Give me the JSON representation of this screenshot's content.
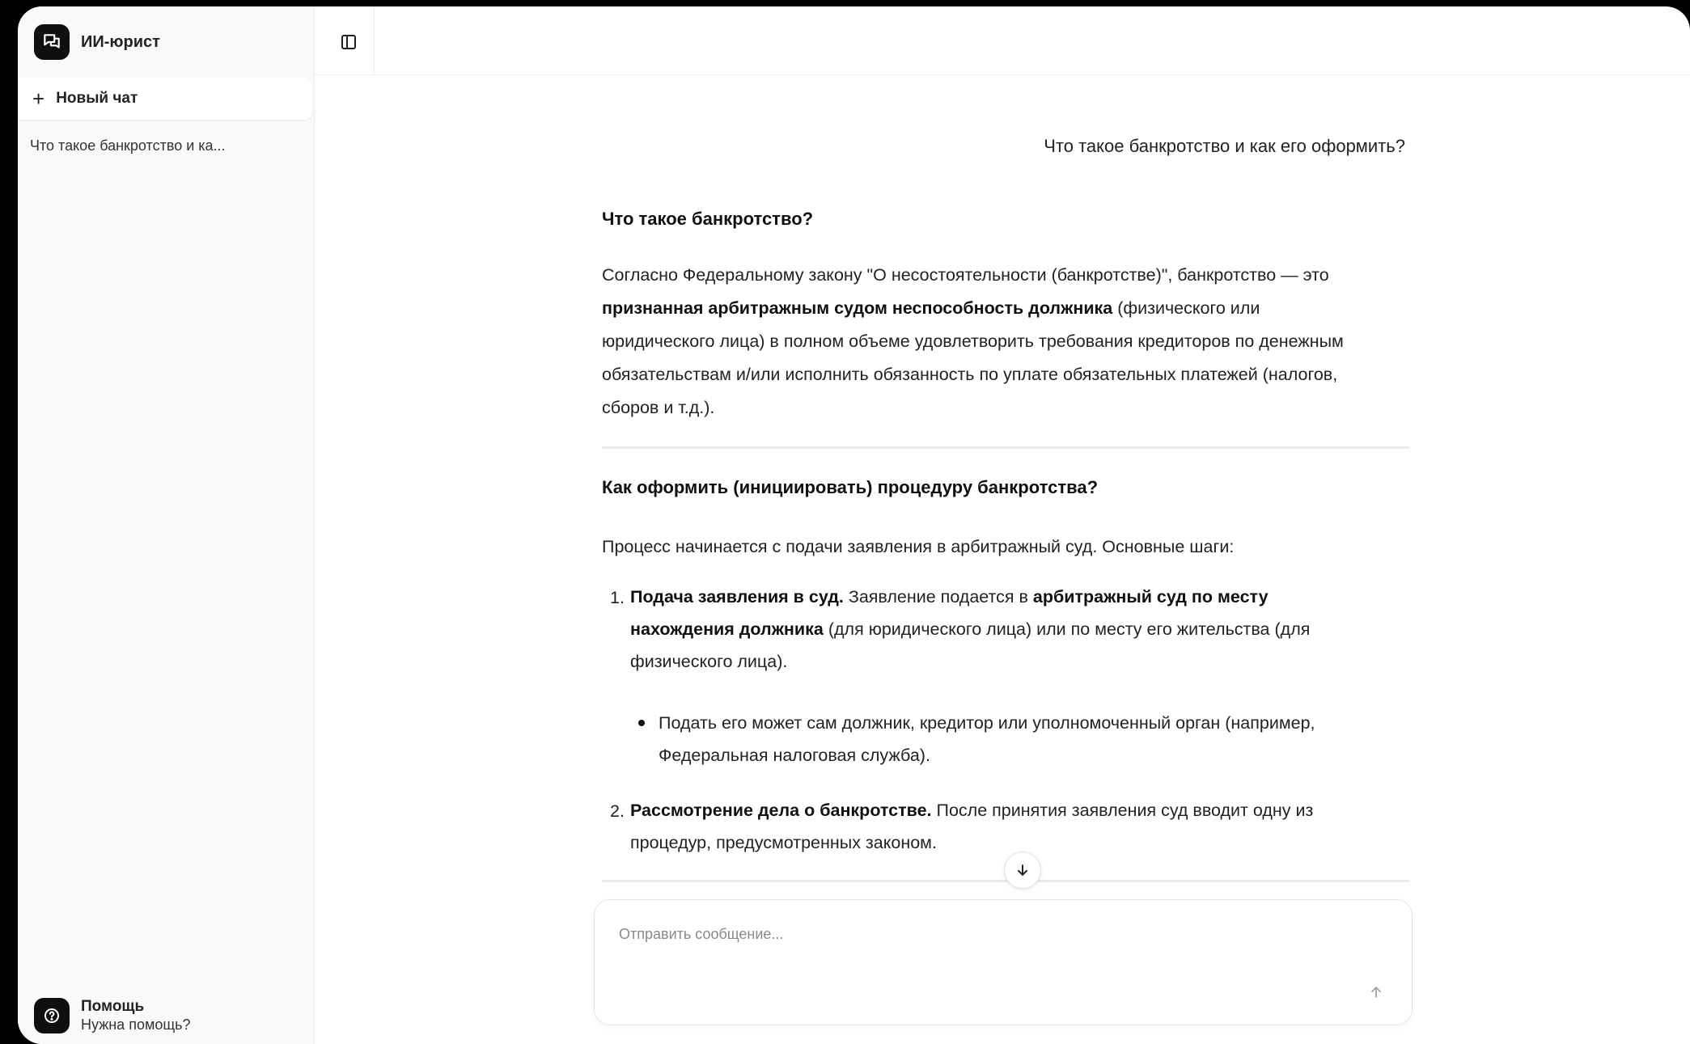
{
  "sidebar": {
    "brand_name": "ИИ-юрист",
    "new_chat_label": "Новый чат",
    "history": [
      "Что такое банкротство и ка..."
    ],
    "help_title": "Помощь",
    "help_subtitle": "Нужна помощь?"
  },
  "chat": {
    "user_message": "Что такое банкротство и как его оформить?",
    "answer": {
      "section1_title": "Что такое банкротство?",
      "section1_p_line1": "Согласно Федеральному закону \"О несостоятельности (банкротстве)\", банкротство — это",
      "section1_p_bold": "признанная арбитражным судом неспособность должника",
      "section1_p_line2_rest": " (физического или",
      "section1_p_line3": "юридического лица) в полном объеме удовлетворить требования кредиторов по денежным",
      "section1_p_line4": "обязательствам и/или исполнить обязанность по уплате обязательных платежей (налогов,",
      "section1_p_line5": "сборов и т.д.).",
      "section2_title": "Как оформить (инициировать) процедуру банкротства?",
      "section2_intro": "Процесс начинается с подачи заявления в арбитражный суд. Основные шаги:",
      "item1_num": "1.",
      "item1_bold": "Подача заявления в суд.",
      "item1_text1": " Заявление подается в ",
      "item1_bold2": "арбитражный суд по месту",
      "item1_bold3": "нахождения должника",
      "item1_text2": " (для юридического лица) или по месту его жительства (для",
      "item1_text3": "физического лица).",
      "bullet1_line1": "Подать его может сам должник, кредитор или уполномоченный орган (например,",
      "bullet1_line2": "Федеральная налоговая служба).",
      "item2_num": "2.",
      "item2_bold": "Рассмотрение дела о банкротстве.",
      "item2_text1": " После принятия заявления суд вводит одну из",
      "item2_text2": "процедур, предусмотренных законом."
    }
  },
  "composer": {
    "placeholder": "Отправить сообщение..."
  },
  "icons": {
    "brand": "chat-bubbles-icon",
    "new_chat": "plus-icon",
    "sidebar_toggle": "sidebar-toggle-icon",
    "scroll_down": "arrow-down-icon",
    "send": "arrow-up-icon",
    "help": "help-bubble-icon"
  }
}
